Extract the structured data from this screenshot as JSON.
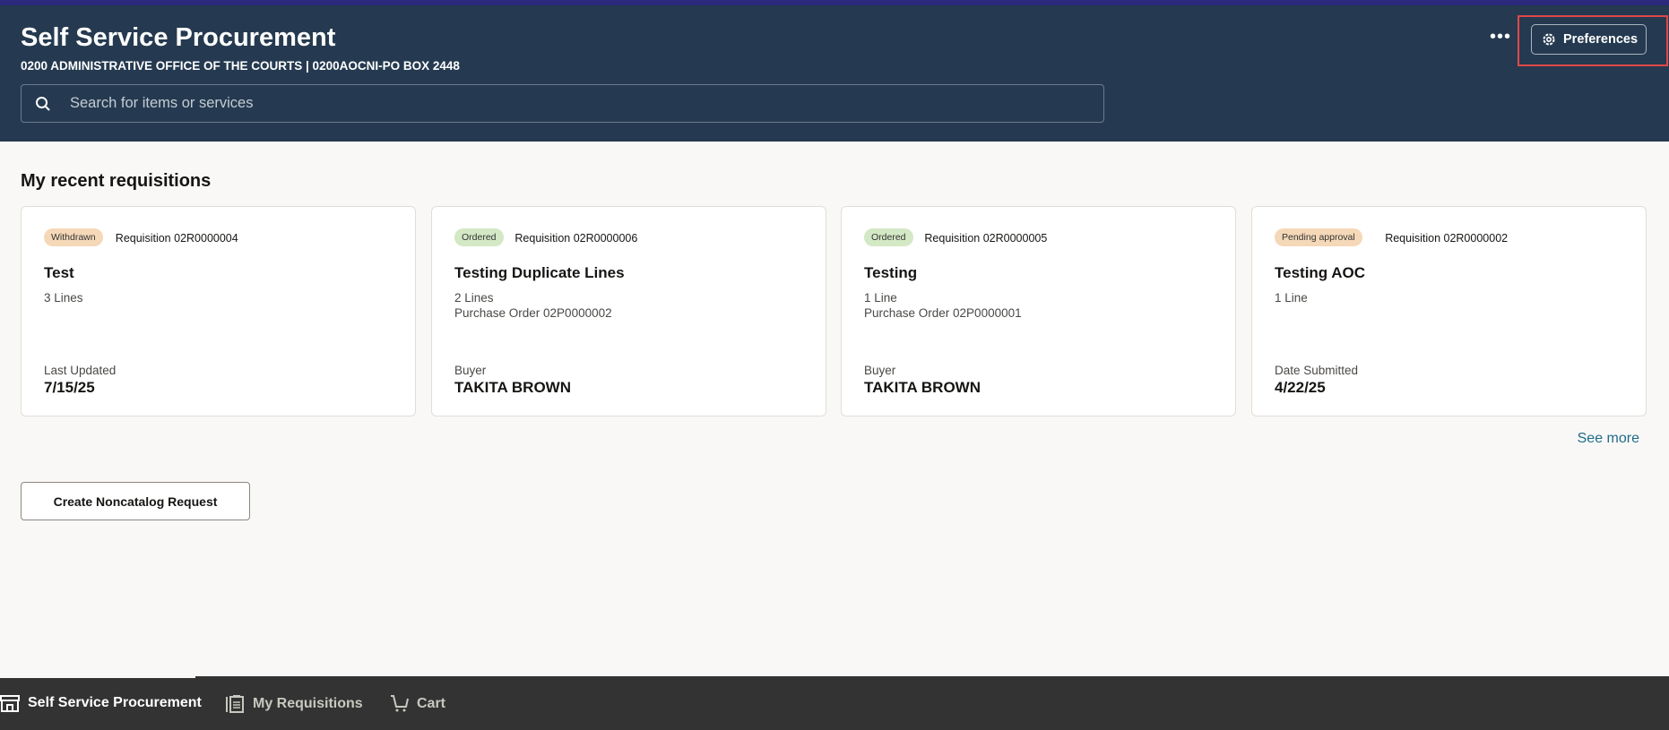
{
  "header": {
    "title": "Self Service Procurement",
    "subtitle": "0200 ADMINISTRATIVE OFFICE OF THE COURTS | 0200AOCNI-PO BOX 2448",
    "search_placeholder": "Search for items or services",
    "more_label": "•••",
    "preferences_label": "Preferences"
  },
  "main": {
    "section_title": "My recent requisitions",
    "see_more": "See more",
    "create_button": "Create Noncatalog Request",
    "cards": [
      {
        "status": "Withdrawn",
        "status_color": "#f5d8b8",
        "requisition": "Requisition 02R0000004",
        "title": "Test",
        "lines": "3 Lines",
        "po": "",
        "field_label": "Last Updated",
        "field_value": "7/15/25"
      },
      {
        "status": "Ordered",
        "status_color": "#d3e8c4",
        "requisition": "Requisition 02R0000006",
        "title": "Testing Duplicate Lines",
        "lines": "2 Lines",
        "po": "Purchase Order 02P0000002",
        "field_label": "Buyer",
        "field_value": "TAKITA BROWN"
      },
      {
        "status": "Ordered",
        "status_color": "#d3e8c4",
        "requisition": "Requisition 02R0000005",
        "title": "Testing",
        "lines": "1 Line",
        "po": "Purchase Order 02P0000001",
        "field_label": "Buyer",
        "field_value": "TAKITA BROWN"
      },
      {
        "status": "Pending approval",
        "status_color": "#f5d8b8",
        "requisition": "Requisition 02R0000002",
        "title": "Testing AOC",
        "lines": "1 Line",
        "po": "",
        "field_label": "Date Submitted",
        "field_value": "4/22/25"
      }
    ]
  },
  "bottom_nav": {
    "items": [
      {
        "label": "Self Service Procurement",
        "icon": "store-icon"
      },
      {
        "label": "My Requisitions",
        "icon": "clipboard-icon"
      },
      {
        "label": "Cart",
        "icon": "cart-icon"
      }
    ]
  }
}
